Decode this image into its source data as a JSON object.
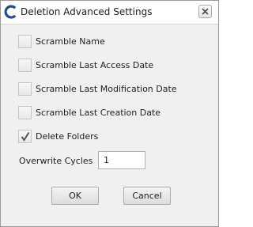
{
  "window": {
    "title": "Deletion Advanced Settings",
    "icon": "ccleaner-c-icon",
    "close_icon": "close-x-icon"
  },
  "options": [
    {
      "label": "Scramble Name",
      "checked": false
    },
    {
      "label": "Scramble Last Access Date",
      "checked": false
    },
    {
      "label": "Scramble Last Modification Date",
      "checked": false
    },
    {
      "label": "Scramble Last Creation Date",
      "checked": false
    },
    {
      "label": "Delete Folders",
      "checked": true
    }
  ],
  "overwrite": {
    "label": "Overwrite Cycles",
    "value": "1"
  },
  "buttons": {
    "ok_label": "OK",
    "cancel_label": "Cancel"
  },
  "colors": {
    "checkmark": "#555555",
    "icon_blue": "#1f4e8c"
  }
}
